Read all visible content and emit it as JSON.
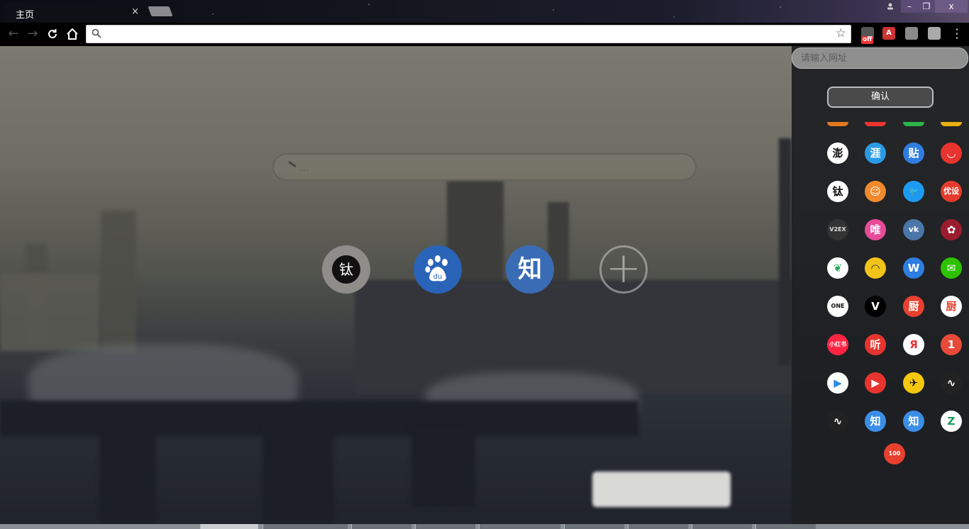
{
  "tab": {
    "title": "主页",
    "close": "×"
  },
  "window": {
    "minimize": "–",
    "maximize": "❐",
    "close": "x"
  },
  "toolbar": {
    "omnibox_value": "",
    "extensions": {
      "off_badge": "off",
      "a_label": "A"
    }
  },
  "main": {
    "search_placeholder": "...",
    "shortcuts": [
      {
        "name": "ti",
        "label": "钛",
        "color": "#8e8d89"
      },
      {
        "name": "baidu",
        "label": "du",
        "color": "#2a64b8"
      },
      {
        "name": "zhihu",
        "label": "知",
        "color": "#3a6cb5"
      },
      {
        "name": "add",
        "label": "+"
      }
    ]
  },
  "sidebar": {
    "url_placeholder": "请输入网址",
    "confirm_label": "确认",
    "apps": [
      {
        "name": "pengpai",
        "label": "澎",
        "bg": "#ffffff",
        "fg": "#111111"
      },
      {
        "name": "ya",
        "label": "涯",
        "bg": "#2b9ae6",
        "fg": "#ffffff"
      },
      {
        "name": "tieba",
        "label": "贴",
        "bg": "#2f7de1",
        "fg": "#ffffff"
      },
      {
        "name": "shop",
        "label": "◡",
        "bg": "#e8342f",
        "fg": "#ffffff"
      },
      {
        "name": "ti-cat",
        "label": "钛",
        "bg": "#ffffff",
        "fg": "#111111"
      },
      {
        "name": "orange-face",
        "label": "☺",
        "bg": "#f08a2c",
        "fg": "#ffffff"
      },
      {
        "name": "twitter",
        "label": "🐦",
        "bg": "#1d9bf0",
        "fg": "#ffffff"
      },
      {
        "name": "youshe",
        "label": "优设",
        "bg": "#e53b2c",
        "fg": "#ffffff"
      },
      {
        "name": "v2ex",
        "label": "V2EX",
        "bg": "#333333",
        "fg": "#dddddd"
      },
      {
        "name": "vip",
        "label": "唯",
        "bg": "#e84a9a",
        "fg": "#ffffff"
      },
      {
        "name": "vk",
        "label": "vk",
        "bg": "#4a76a8",
        "fg": "#ffffff"
      },
      {
        "name": "doodle",
        "label": "✿",
        "bg": "#9b1c2e",
        "fg": "#ffffff"
      },
      {
        "name": "feather",
        "label": "❦",
        "bg": "#ffffff",
        "fg": "#2aa35a"
      },
      {
        "name": "mountain",
        "label": "◠",
        "bg": "#f2c318",
        "fg": "#333333"
      },
      {
        "name": "wu",
        "label": "W",
        "bg": "#2f7de1",
        "fg": "#ffffff"
      },
      {
        "name": "wechat",
        "label": "✉",
        "bg": "#2dc100",
        "fg": "#ffffff"
      },
      {
        "name": "one",
        "label": "ONE",
        "bg": "#ffffff",
        "fg": "#111111"
      },
      {
        "name": "v-logo",
        "label": "V",
        "bg": "#000000",
        "fg": "#ffffff"
      },
      {
        "name": "xiachufang",
        "label": "厨",
        "bg": "#e8402f",
        "fg": "#ffffff"
      },
      {
        "name": "xiachufang-2",
        "label": "厨",
        "bg": "#ffffff",
        "fg": "#e8402f"
      },
      {
        "name": "xiaohongshu",
        "label": "小红书",
        "bg": "#ff2442",
        "fg": "#ffffff"
      },
      {
        "name": "ting",
        "label": "听",
        "bg": "#e8342f",
        "fg": "#ffffff"
      },
      {
        "name": "yandex",
        "label": "Я",
        "bg": "#ffffff",
        "fg": "#e33"
      },
      {
        "name": "one-red",
        "label": "1",
        "bg": "#e84a3a",
        "fg": "#ffffff"
      },
      {
        "name": "play-blue",
        "label": "▶",
        "bg": "#ffffff",
        "fg": "#2a8de0"
      },
      {
        "name": "youtube",
        "label": "▶",
        "bg": "#e8342f",
        "fg": "#ffffff"
      },
      {
        "name": "rocket",
        "label": "✈",
        "bg": "#f5c80f",
        "fg": "#111111"
      },
      {
        "name": "pulse",
        "label": "∿",
        "bg": "#222222",
        "fg": "#ffffff"
      },
      {
        "name": "pulse-2",
        "label": "∿",
        "bg": "#222222",
        "fg": "#ffffff"
      },
      {
        "name": "zhihu-1",
        "label": "知",
        "bg": "#3a8ee6",
        "fg": "#ffffff"
      },
      {
        "name": "zhihu-2",
        "label": "知",
        "bg": "#3a8ee6",
        "fg": "#ffffff"
      },
      {
        "name": "z-logo",
        "label": "Z",
        "bg": "#ffffff",
        "fg": "#1a9a5a"
      },
      {
        "name": "hundred",
        "label": "100",
        "bg": "#e8402f",
        "fg": "#ffffff"
      }
    ]
  }
}
